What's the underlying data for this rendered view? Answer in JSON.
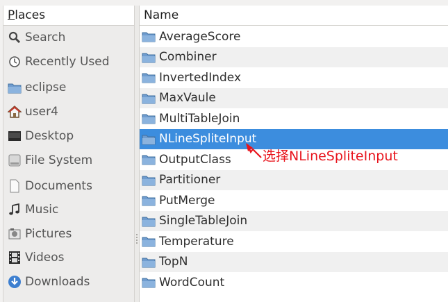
{
  "sidebar": {
    "header": {
      "mnemonic": "P",
      "rest": "laces"
    },
    "items": [
      {
        "label": "Search",
        "icon": "search-icon"
      },
      {
        "label": "Recently Used",
        "icon": "clock-icon"
      },
      {
        "label": "eclipse",
        "icon": "folder-icon"
      },
      {
        "label": "user4",
        "icon": "home-icon"
      },
      {
        "label": "Desktop",
        "icon": "desktop-icon"
      },
      {
        "label": "File System",
        "icon": "harddisk-icon"
      },
      {
        "label": "Documents",
        "icon": "document-icon"
      },
      {
        "label": "Music",
        "icon": "music-note-icon"
      },
      {
        "label": "Pictures",
        "icon": "pictures-icon"
      },
      {
        "label": "Videos",
        "icon": "film-icon"
      },
      {
        "label": "Downloads",
        "icon": "download-icon"
      }
    ]
  },
  "filelist": {
    "column_header": "Name",
    "selected_index": 5,
    "rows": [
      "AverageScore",
      "Combiner",
      "InvertedIndex",
      "MaxVaule",
      "MultiTableJoin",
      "NLineSpliteInput",
      "OutputClass",
      "Partitioner",
      "PutMerge",
      "SingleTableJoin",
      "Temperature",
      "TopN",
      "WordCount"
    ]
  },
  "annotation": {
    "text": "选择NLineSpliteInput",
    "color": "#e8141c"
  },
  "colors": {
    "selection": "#3c8dde",
    "folder": "#5b8fc7"
  }
}
